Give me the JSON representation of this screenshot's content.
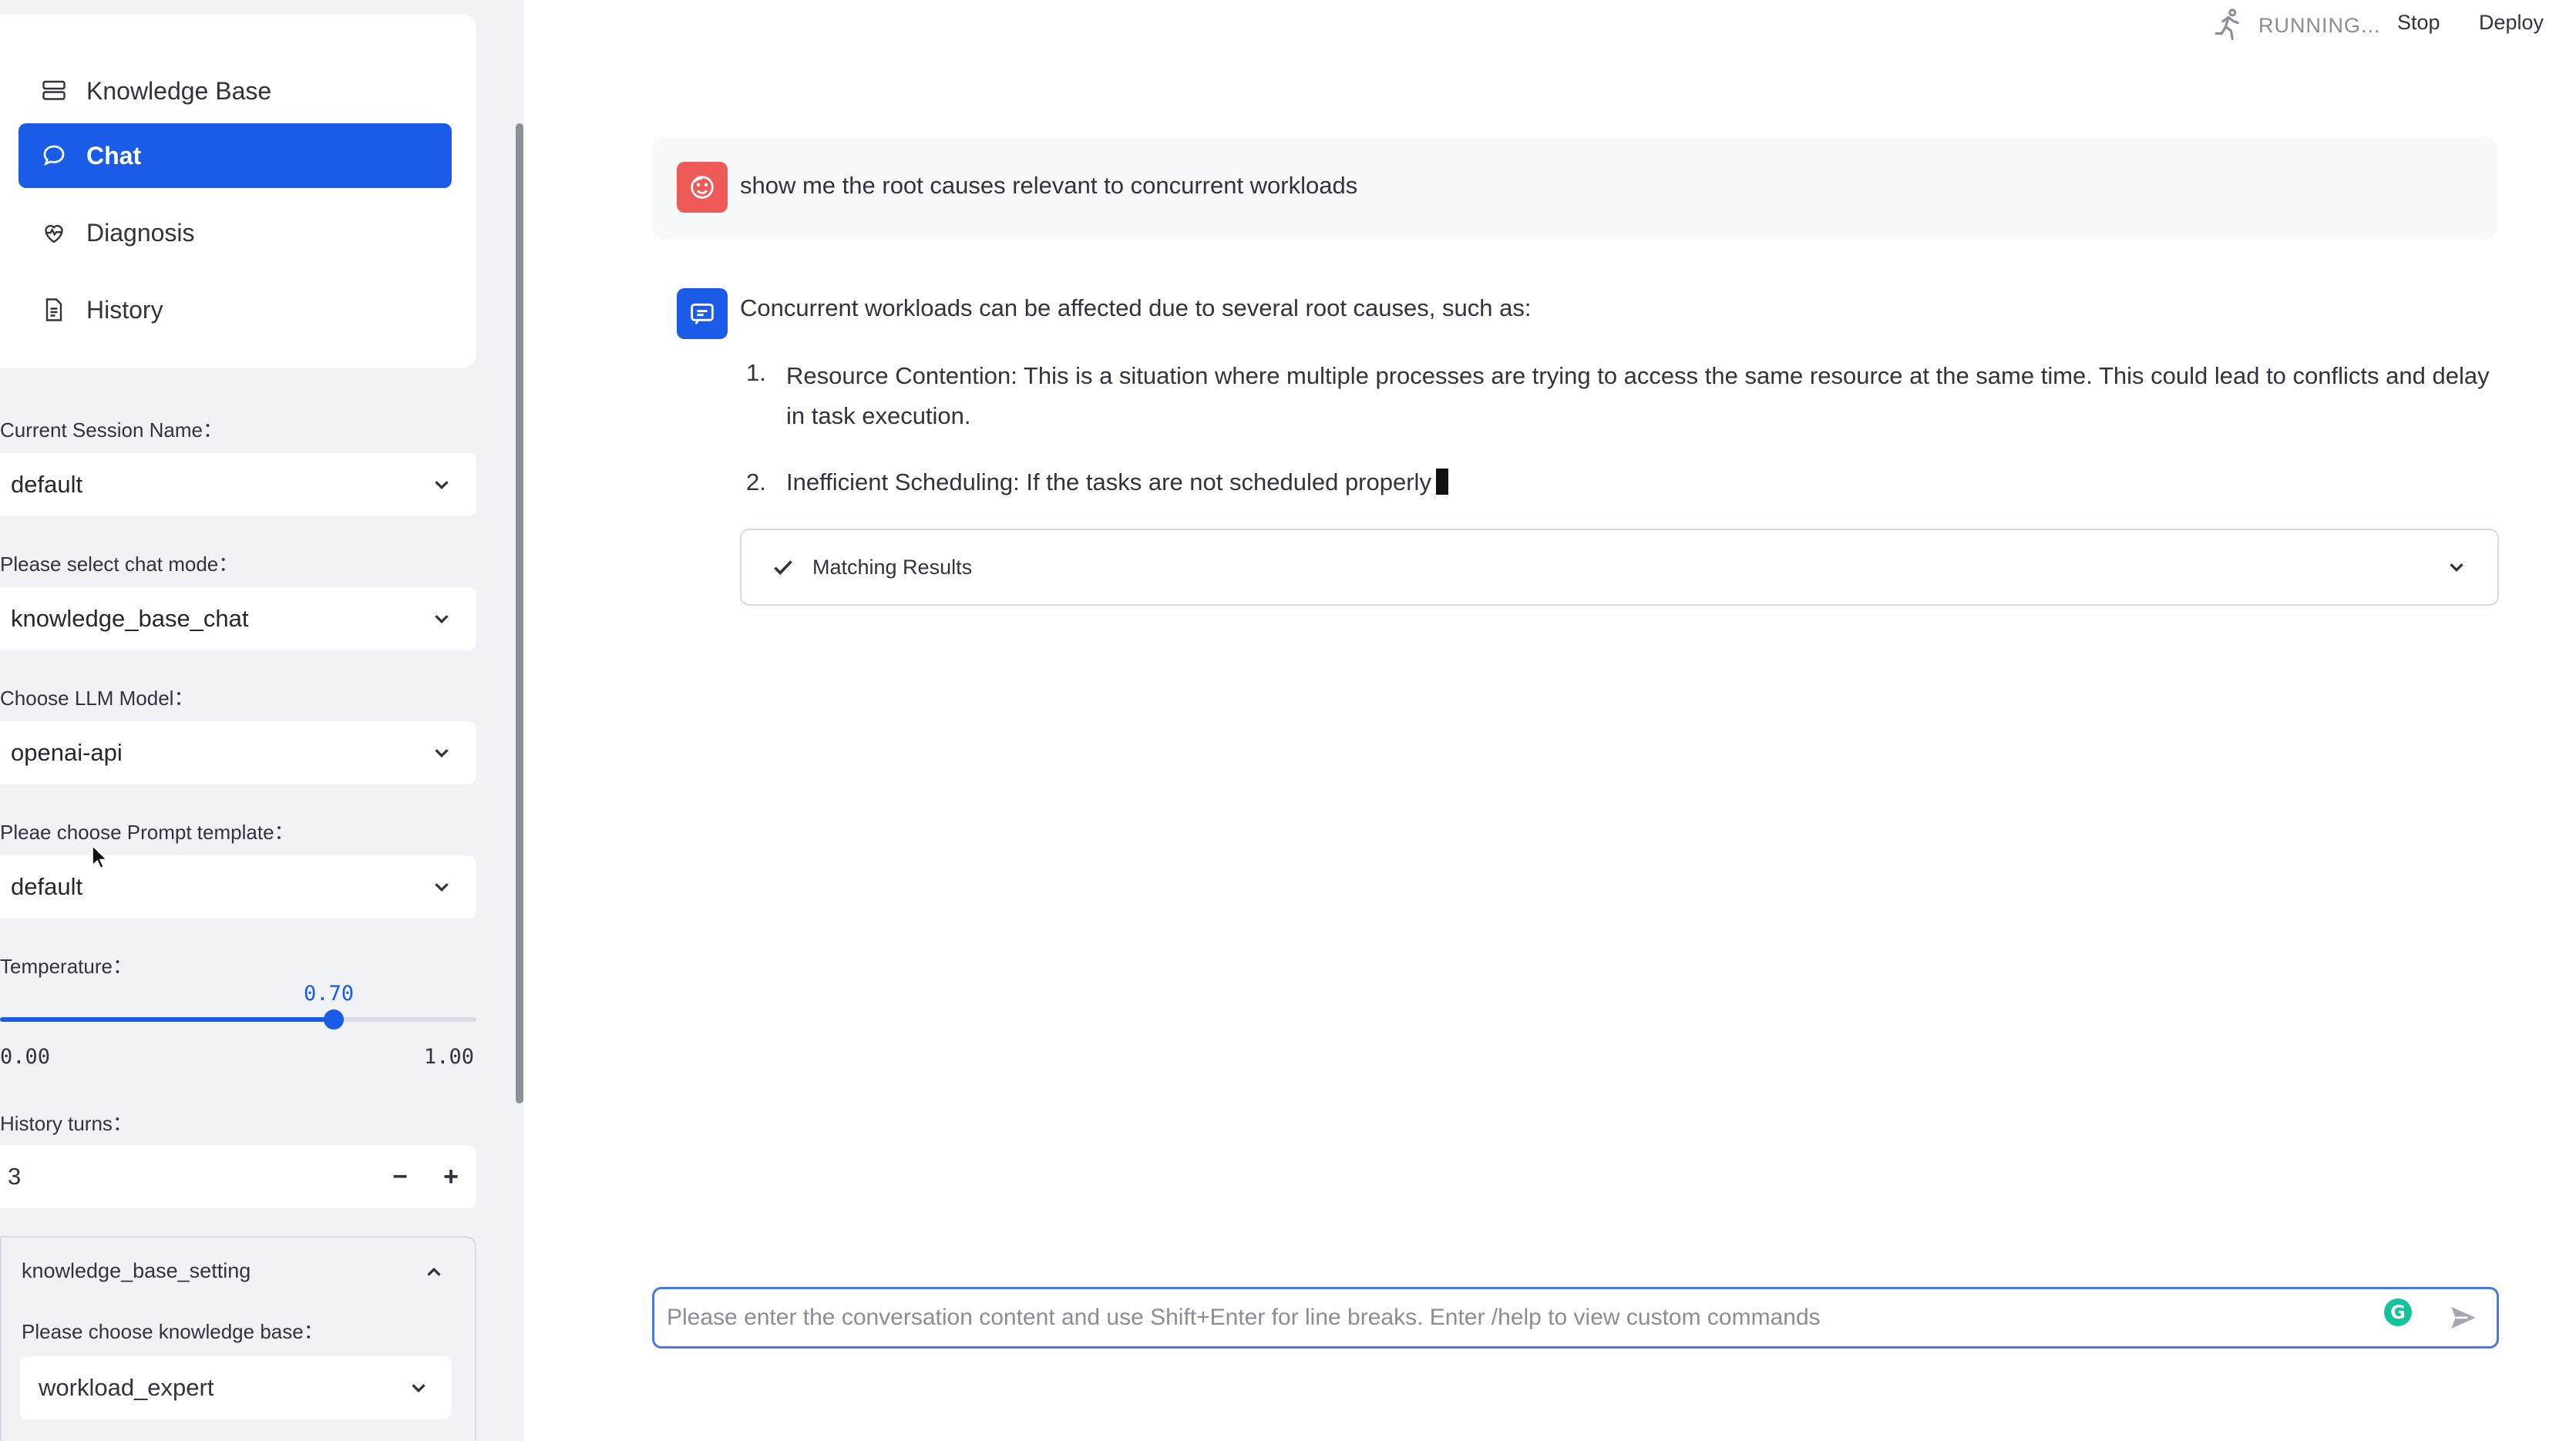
{
  "colors": {
    "accent": "#1a5ce8",
    "sidebar_bg": "#f0f2f6",
    "user_avatar": "#ee5a58",
    "assistant_avatar": "#1a5ce8",
    "grammarly": "#15c39a"
  },
  "nav": {
    "items": [
      {
        "label": "Knowledge Base",
        "icon": "database-icon",
        "active": false
      },
      {
        "label": "Chat",
        "icon": "chat-bubble-icon",
        "active": true
      },
      {
        "label": "Diagnosis",
        "icon": "heart-pulse-icon",
        "active": false
      },
      {
        "label": "History",
        "icon": "document-icon",
        "active": false
      }
    ]
  },
  "sidebar": {
    "session_label": "Current Session Name：",
    "session_value": "default",
    "chat_mode_label": "Please select chat mode：",
    "chat_mode_value": "knowledge_base_chat",
    "llm_label": "Choose LLM Model：",
    "llm_value": "openai-api",
    "prompt_label": "Pleae choose Prompt template：",
    "prompt_value": "default",
    "temperature_label": "Temperature：",
    "temperature_value": "0.70",
    "temperature_fraction": 0.7,
    "temperature_min": "0.00",
    "temperature_max": "1.00",
    "history_label": "History turns：",
    "history_value": "3",
    "stepper_minus": "−",
    "stepper_plus": "+",
    "kb_setting_title": "knowledge_base_setting",
    "kb_choose_label": "Please choose knowledge base：",
    "kb_value": "workload_expert"
  },
  "topbar": {
    "status": "RUNNING...",
    "stop": "Stop",
    "deploy": "Deploy"
  },
  "chat": {
    "user_message": "show me the root causes relevant to concurrent workloads",
    "assistant_intro": "Concurrent workloads can be affected due to several root causes, such as:",
    "list": [
      {
        "num": "1.",
        "text": "Resource Contention: This is a situation where multiple processes are trying to access the same resource at the same time. This could lead to conflicts and delay in task execution."
      },
      {
        "num": "2.",
        "text": "Inefficient Scheduling: If the tasks are not scheduled properly"
      }
    ],
    "expander_label": "Matching Results",
    "input_placeholder": "Please enter the conversation content and use Shift+Enter for line breaks. Enter /help to view custom commands",
    "grammarly_letter": "G"
  }
}
